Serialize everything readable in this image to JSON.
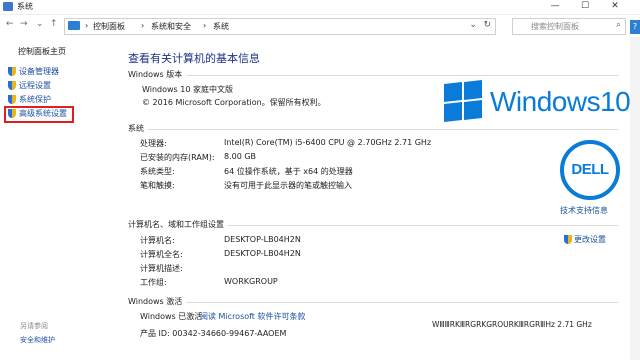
{
  "window": {
    "title": "系统",
    "minimize": "—",
    "maximize": "☐",
    "close": "✕"
  },
  "address": {
    "breadcrumbs": [
      "控制面板",
      "系统和安全",
      "系统"
    ],
    "search_placeholder": "搜索控制面板",
    "back": "←",
    "forward": "→",
    "up": "↑",
    "refresh": "↻",
    "dropdown": "⌄"
  },
  "sidebar": {
    "home": "控制面板主页",
    "items": [
      {
        "label": "设备管理器"
      },
      {
        "label": "远程设置"
      },
      {
        "label": "系统保护"
      },
      {
        "label": "高级系统设置"
      }
    ],
    "footer_heading": "另请参阅",
    "footer_link": "安全和维护"
  },
  "main": {
    "heading": "查看有关计算机的基本信息",
    "edition": {
      "section": "Windows 版本",
      "name": "Windows 10 家庭中文版",
      "copyright": "© 2016 Microsoft Corporation。保留所有权利。",
      "logo_text": "Windows10"
    },
    "system": {
      "section": "系统",
      "rows": [
        {
          "label": "处理器:",
          "value": "Intel(R) Core(TM) i5-6400 CPU @ 2.70GHz   2.71 GHz"
        },
        {
          "label": "已安装的内存(RAM):",
          "value": "8.00 GB"
        },
        {
          "label": "系统类型:",
          "value": "64 位操作系统，基于 x64 的处理器"
        },
        {
          "label": "笔和触摸:",
          "value": "没有可用于此显示器的笔或触控输入"
        }
      ],
      "oem_logo": "DELL",
      "support_link": "技术支持信息"
    },
    "computer": {
      "section": "计算机名、域和工作组设置",
      "rows": [
        {
          "label": "计算机名:",
          "value": "DESKTOP-LB04H2N"
        },
        {
          "label": "计算机全名:",
          "value": "DESKTOP-LB04H2N"
        },
        {
          "label": "计算机描述:",
          "value": ""
        },
        {
          "label": "工作组:",
          "value": "WORKGROUP"
        }
      ],
      "change_link": "更改设置"
    },
    "activation": {
      "section": "Windows 激活",
      "status": "Windows 已激活",
      "license_link": "阅读 Microsoft 软件许可条款",
      "product_id": "产品 ID: 00342-34660-99467-AAOEM",
      "overlap_text": "WⅢⅢRKⅢRGRKGROURKⅢRGRⅢHz   2.71 GHz"
    }
  }
}
